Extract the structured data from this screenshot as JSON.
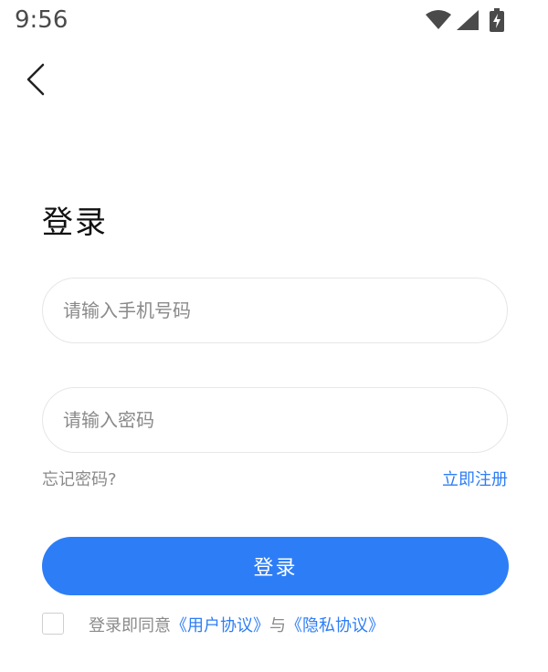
{
  "status_bar": {
    "time": "9:56",
    "icons": [
      "wifi-icon",
      "signal-icon",
      "battery-charging-icon"
    ]
  },
  "nav": {
    "back_icon": "chevron-left-icon"
  },
  "title": "登录",
  "form": {
    "phone_placeholder": "请输入手机号码",
    "password_placeholder": "请输入密码",
    "forgot_password": "忘记密码?",
    "register": "立即注册",
    "login_button": "登录"
  },
  "agreement": {
    "checked": false,
    "prefix": "登录即同意",
    "user_agreement": "《用户协议》",
    "connector": "与",
    "privacy_agreement": "《隐私协议》"
  },
  "colors": {
    "accent": "#2d7df6",
    "muted_text": "#8a8a8a",
    "border": "#e6e6e6"
  }
}
